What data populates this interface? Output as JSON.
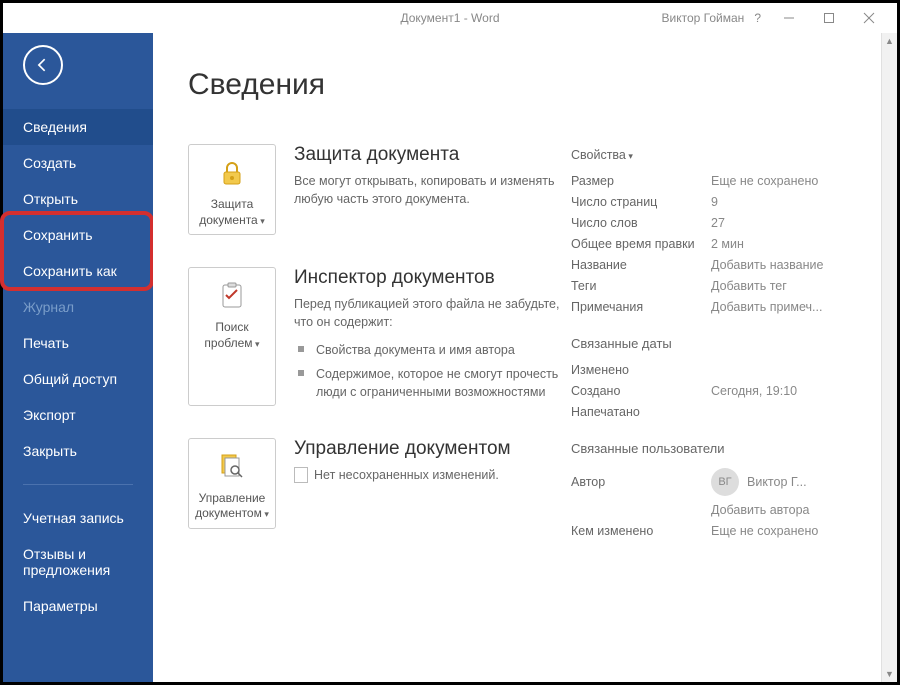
{
  "titlebar": {
    "title": "Документ1  -  Word",
    "user": "Виктор Гойман",
    "help": "?"
  },
  "sidebar": {
    "items": [
      {
        "label": "Сведения",
        "active": true
      },
      {
        "label": "Создать"
      },
      {
        "label": "Открыть"
      },
      {
        "label": "Сохранить"
      },
      {
        "label": "Сохранить как"
      },
      {
        "label": "Журнал",
        "disabled": true
      },
      {
        "label": "Печать"
      },
      {
        "label": "Общий доступ"
      },
      {
        "label": "Экспорт"
      },
      {
        "label": "Закрыть"
      },
      {
        "label": "Учетная запись"
      },
      {
        "label": "Отзывы и предложения"
      },
      {
        "label": "Параметры"
      }
    ]
  },
  "page": {
    "title": "Сведения",
    "sections": {
      "protect": {
        "button": "Защита документа",
        "title": "Защита документа",
        "desc": "Все могут открывать, копировать и изменять любую часть этого документа."
      },
      "inspect": {
        "button": "Поиск проблем",
        "title": "Инспектор документов",
        "desc": "Перед публикацией этого файла не забудьте, что он содержит:",
        "bullets": [
          "Свойства документа и имя автора",
          "Содержимое, которое не смогут прочесть люди с ограниченными возможностями"
        ]
      },
      "manage": {
        "button": "Управление документом",
        "title": "Управление документом",
        "desc": "Нет несохраненных изменений."
      }
    },
    "properties": {
      "header": "Свойства",
      "rows": {
        "size": {
          "label": "Размер",
          "value": "Еще не сохранено"
        },
        "pages": {
          "label": "Число страниц",
          "value": "9"
        },
        "words": {
          "label": "Число слов",
          "value": "27"
        },
        "edit_time": {
          "label": "Общее время правки",
          "value": "2 мин"
        },
        "title": {
          "label": "Название",
          "value": "Добавить название"
        },
        "tags": {
          "label": "Теги",
          "value": "Добавить тег"
        },
        "comments": {
          "label": "Примечания",
          "value": "Добавить примеч..."
        }
      },
      "dates": {
        "header": "Связанные даты",
        "modified": {
          "label": "Изменено",
          "value": ""
        },
        "created": {
          "label": "Создано",
          "value": "Сегодня, 19:10"
        },
        "printed": {
          "label": "Напечатано",
          "value": ""
        }
      },
      "users": {
        "header": "Связанные пользователи",
        "author_label": "Автор",
        "author_initials": "ВГ",
        "author_name": "Виктор Г...",
        "add_author": "Добавить автора",
        "modified_by_label": "Кем изменено",
        "modified_by_value": "Еще не сохранено"
      }
    }
  }
}
